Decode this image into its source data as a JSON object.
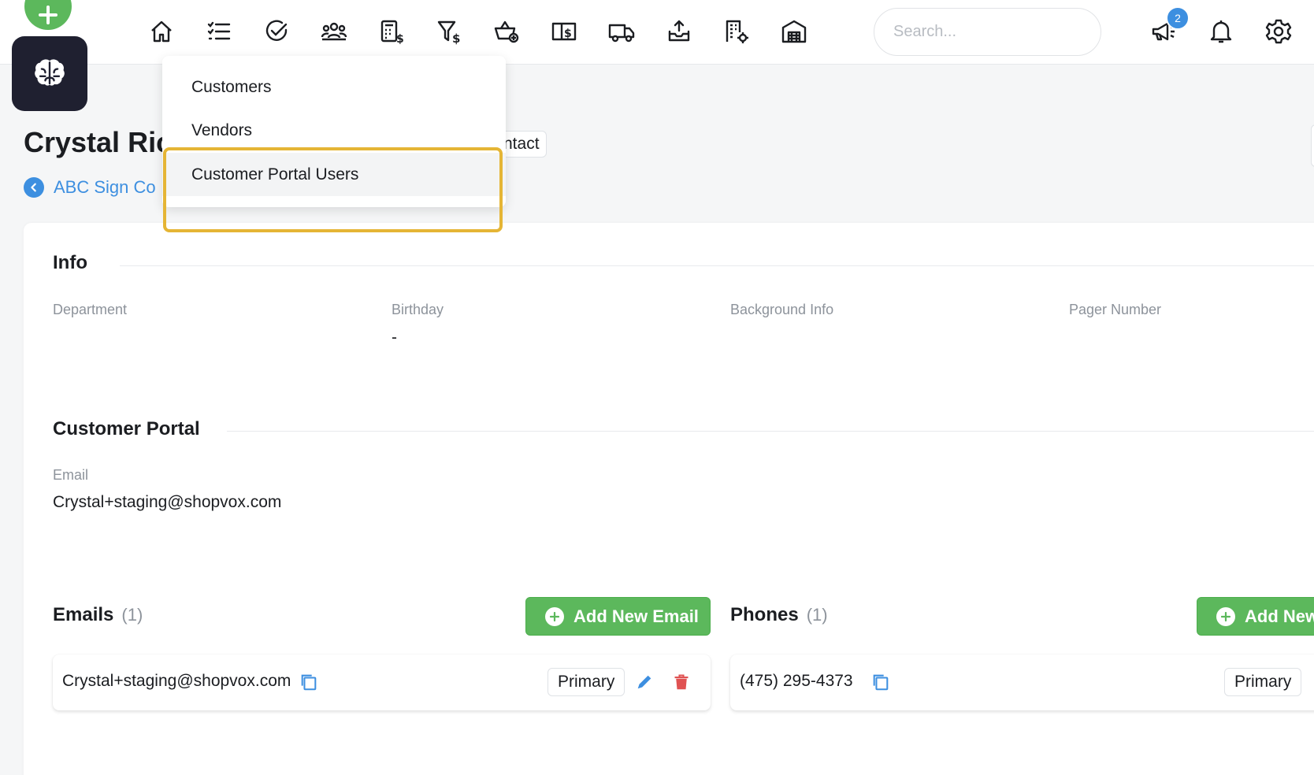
{
  "topbar": {
    "search_placeholder": "Search...",
    "notification_badge": "2",
    "nav_icons": [
      "home-icon",
      "task-list-icon",
      "check-circle-icon",
      "contacts-group-icon",
      "invoice-calculator-icon",
      "sales-funnel-icon",
      "basket-add-icon",
      "book-dollar-icon",
      "delivery-truck-icon",
      "inbox-upload-icon",
      "building-gear-icon",
      "warehouse-icon"
    ]
  },
  "colors": {
    "accent": "#3d8fe0",
    "green": "#5cb85c",
    "highlight": "#e5b535",
    "danger": "#e05252"
  },
  "page": {
    "title": "Crystal Ric",
    "back_link": "ABC Sign Co",
    "contact_button": "ntact"
  },
  "dropdown": {
    "items": [
      "Customers",
      "Vendors",
      "Customer Portal Users"
    ]
  },
  "info": {
    "title": "Info",
    "fields": [
      {
        "label": "Department",
        "value": ""
      },
      {
        "label": "Birthday",
        "value": "-"
      },
      {
        "label": "Background Info",
        "value": ""
      },
      {
        "label": "Pager Number",
        "value": ""
      }
    ]
  },
  "customer_portal": {
    "title": "Customer Portal",
    "email_label": "Email",
    "email_value": "Crystal+staging@shopvox.com"
  },
  "emails": {
    "title": "Emails",
    "count": "(1)",
    "add_button": "Add New Email",
    "items": [
      {
        "value": "Crystal+staging@shopvox.com",
        "tag": "Primary"
      }
    ]
  },
  "phones": {
    "title": "Phones",
    "count": "(1)",
    "add_button": "Add New",
    "items": [
      {
        "value": "(475) 295-4373",
        "tag": "Primary"
      }
    ]
  }
}
